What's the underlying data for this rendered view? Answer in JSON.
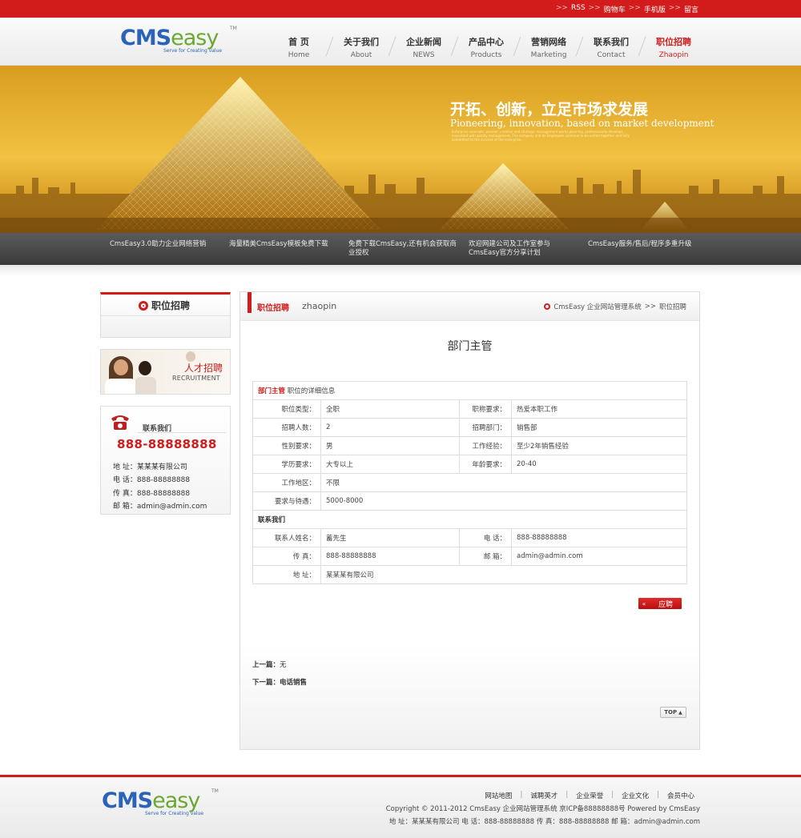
{
  "topbar": {
    "links": [
      "RSS",
      "购物车",
      "手机版",
      "留言"
    ],
    "separator": ">>"
  },
  "logo": {
    "cms": "CMS",
    "easy": "easy",
    "tm": "TM",
    "tagline": "Serve for Creating value"
  },
  "nav": [
    {
      "cn": "首 页",
      "en": "Home"
    },
    {
      "cn": "关于我们",
      "en": "About"
    },
    {
      "cn": "企业新闻",
      "en": "NEWS"
    },
    {
      "cn": "产品中心",
      "en": "Products"
    },
    {
      "cn": "营销网络",
      "en": "Marketing"
    },
    {
      "cn": "联系我们",
      "en": "Contact"
    },
    {
      "cn": "职位招聘",
      "en": "Zhaopin"
    }
  ],
  "banner": {
    "slogan_cn": "开拓、创新，立足市场求发展",
    "slogan_en": "Pioneering, innovation, based on market development",
    "slogan_small": "Enterprise concepts: pioneer, creative and strategic management works planning, professionally develops, innovated with quality management, The company and its Employees continue to be united together and fully committed to the success of the enterprise."
  },
  "news": [
    "CmsEasy3.0助力企业网络营销",
    "海量精美CmsEasy模板免费下载",
    "免费下载CmsEasy,还有机会获取商业授权",
    "欢迎网建公司及工作室参与CmsEasy官方分享计划",
    "CmsEasy服务/售后/程序多重升级"
  ],
  "sidebar": {
    "title": "职位招聘",
    "recruit_cn": "人才招聘",
    "recruit_en": "RECRUITMENT",
    "contact_title": "联系我们",
    "contact_phone": "888-88888888",
    "contact_lines": [
      "地 址：某某某有限公司",
      "电 话：888-88888888",
      "传 真：888-88888888",
      "邮 箱：admin@admin.com"
    ]
  },
  "main": {
    "header_cn": "职位招聘",
    "header_en": "zhaopin",
    "breadcrumb_home": "CmsEasy 企业网站管理系统",
    "breadcrumb_sep": ">>",
    "breadcrumb_current": "职位招聘",
    "job_title": "部门主管",
    "caption_red": "部门主管",
    "caption_rest": "职位的详细信息",
    "rows": [
      {
        "l1": "职位类型：",
        "v1": "全职",
        "l2": "职称要求：",
        "v2": "热爱本职工作"
      },
      {
        "l1": "招聘人数：",
        "v1": "2",
        "l2": "招聘部门：",
        "v2": "销售部"
      },
      {
        "l1": "性别要求：",
        "v1": "男",
        "l2": "工作经验：",
        "v2": "至少2年销售经验"
      },
      {
        "l1": "学历要求：",
        "v1": "大专以上",
        "l2": "年龄要求：",
        "v2": "20-40"
      }
    ],
    "area_label": "工作地区：",
    "area_value": "不限",
    "salary_label": "要求与待遇：",
    "salary_value": "5000-8000",
    "contact_section": "联系我们",
    "contact_person_label": "联系人姓名：",
    "contact_person_value": "蓄先生",
    "tel_label": "电 话：",
    "tel_value": "888-88888888",
    "fax_label": "传 真：",
    "fax_value": "888-88888888",
    "email_label": "邮 箱：",
    "email_value": "admin@admin.com",
    "addr_label": "地 址：",
    "addr_value": "某某某有限公司",
    "apply_arrow": "«",
    "apply_label": "应聘",
    "prev_label": "上一篇：",
    "prev_value": "无",
    "next_label": "下一篇：",
    "next_value": "电话销售",
    "top_label": "TOP"
  },
  "footer": {
    "links": [
      "网站地图",
      "诚聘英才",
      "企业荣誉",
      "企业文化",
      "会员中心"
    ],
    "sep": "|",
    "copyright": "Copyright © 2011-2012  CmsEasy 企业网站管理系统  京ICP备88888888号  Powered by CmsEasy",
    "address": "地 址：某某某有限公司 电 话：888-88888888 传 真：888-88888888 邮 箱：admin@admin.com"
  },
  "colors": {
    "brand_red": "#d21c1c",
    "logo_blue": "#2b63b8",
    "logo_green": "#6aa832"
  }
}
